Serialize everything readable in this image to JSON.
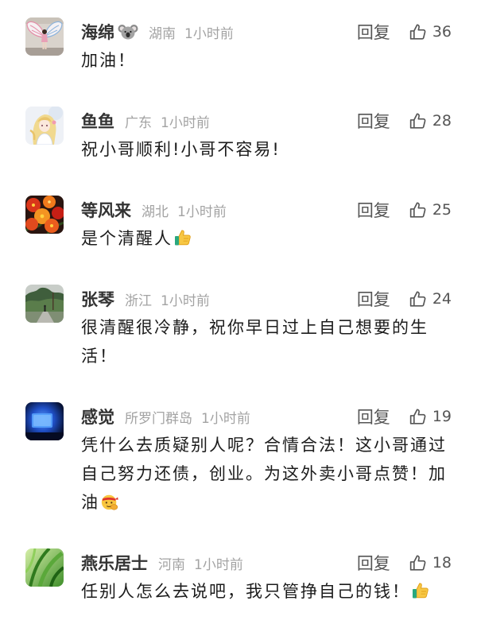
{
  "comments": [
    {
      "avatar": "avatar-angel-wings-photo",
      "name": "海绵",
      "name_emoji_icon": "koala-icon",
      "location": "湖南",
      "time": "1小时前",
      "reply_label": "回复",
      "likes": "36",
      "content": "加油！"
    },
    {
      "avatar": "avatar-anime-girl",
      "name": "鱼鱼",
      "location": "广东",
      "time": "1小时前",
      "reply_label": "回复",
      "likes": "28",
      "content": "祝小哥顺利!小哥不容易!"
    },
    {
      "avatar": "avatar-red-flowers",
      "name": "等风来",
      "location": "湖北",
      "time": "1小时前",
      "reply_label": "回复",
      "likes": "25",
      "content": "是个清醒人",
      "content_emoji_icon": "thumbs-up-emoji-icon"
    },
    {
      "avatar": "avatar-park-trees",
      "name": "张琴",
      "location": "浙江",
      "time": "1小时前",
      "reply_label": "回复",
      "likes": "24",
      "content": "很清醒很冷静，祝你早日过上自己想要的生活！"
    },
    {
      "avatar": "avatar-blue-screen",
      "name": "感觉",
      "location": "所罗门群岛",
      "time": "1小时前",
      "reply_label": "回复",
      "likes": "19",
      "content": "凭什么去质疑别人呢？合情合法！这小哥通过自己努力还债，创业。为这外卖小哥点赞！加油",
      "content_emoji_icon": "fighting-emoji-icon"
    },
    {
      "avatar": "avatar-green-leaves",
      "name": "燕乐居士",
      "location": "河南",
      "time": "1小时前",
      "reply_label": "回复",
      "likes": "18",
      "content": "任别人怎么去说吧，我只管挣自己的钱！",
      "content_emoji_icon": "thumbs-up-emoji-icon"
    }
  ],
  "icons": {
    "like": "thumbs-up-outline-icon"
  },
  "colors": {
    "background": "#ffffff",
    "name": "#333333",
    "meta": "#a3a3a3",
    "action": "#555555",
    "content": "#1c1c1c"
  }
}
